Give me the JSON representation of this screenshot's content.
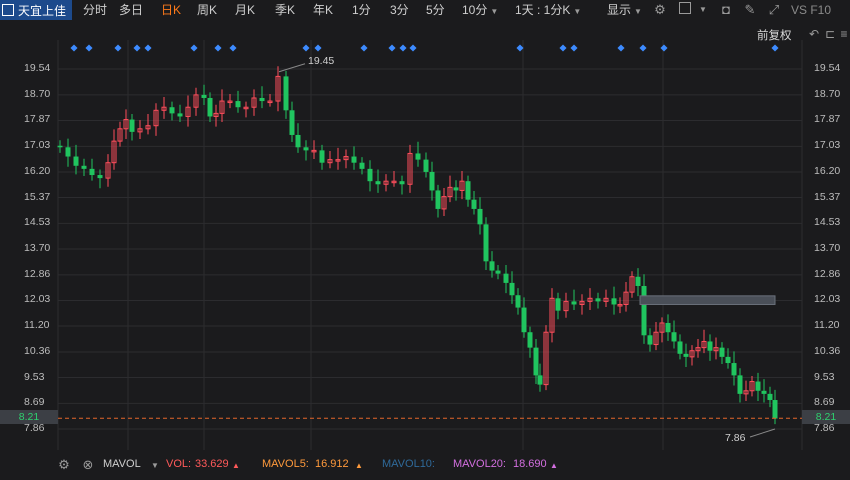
{
  "toolbar": {
    "stock_name": "天宜上佳",
    "tabs": [
      {
        "label": "分时"
      },
      {
        "label": "多日"
      },
      {
        "label": "日K"
      },
      {
        "label": "周K"
      },
      {
        "label": "月K"
      },
      {
        "label": "季K"
      },
      {
        "label": "年K"
      },
      {
        "label": "1分"
      },
      {
        "label": "3分"
      },
      {
        "label": "5分"
      },
      {
        "label": "10分"
      },
      {
        "label": "1天 : 1分K"
      }
    ],
    "active_tab": "日K",
    "display_label": "显示",
    "right_text": "VS F10",
    "adjust_label": "前复权"
  },
  "chart_data": {
    "type": "candlestick",
    "y_ticks": [
      "19.54",
      "18.70",
      "17.87",
      "17.03",
      "16.20",
      "15.37",
      "14.53",
      "13.70",
      "12.86",
      "12.03",
      "11.20",
      "10.36",
      "9.53",
      "8.69",
      "7.86"
    ],
    "ylim": [
      7.86,
      19.54
    ],
    "high_label": "19.45",
    "low_label": "7.86",
    "current_price": "8.21",
    "colors": {
      "up": "#ff4d5b",
      "down": "#20c55f",
      "marker": "#3d8bff"
    }
  },
  "indicator": {
    "name": "MAVOL",
    "vol_label": "VOL:",
    "vol_value": "33.629",
    "mavol5_label": "MAVOL5:",
    "mavol5_value": "16.912",
    "mavol10_label": "MAVOL10:",
    "mavol20_label": "MAVOL20:",
    "mavol20_value": "18.690"
  }
}
